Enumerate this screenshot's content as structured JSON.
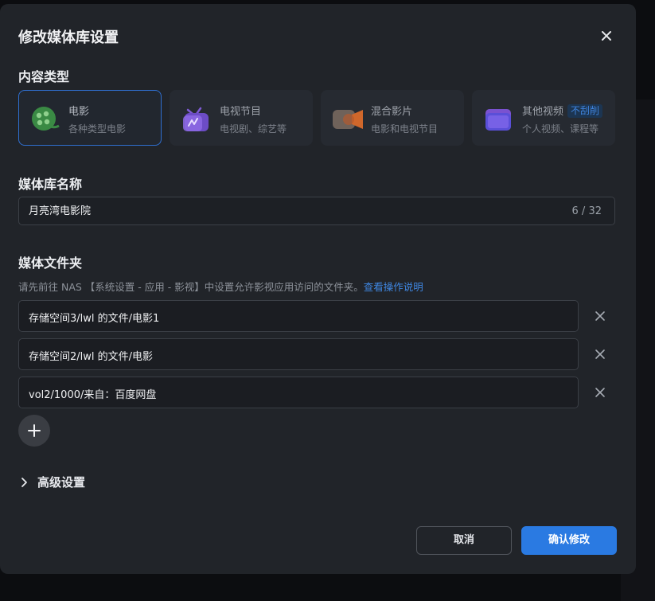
{
  "dialog": {
    "title": "修改媒体库设置"
  },
  "content_type": {
    "label": "内容类型",
    "options": [
      {
        "title": "电影",
        "subtitle": "各种类型电影",
        "icon": "film-reel-icon",
        "selected": true
      },
      {
        "title": "电视节目",
        "subtitle": "电视剧、综艺等",
        "icon": "tv-icon",
        "selected": false
      },
      {
        "title": "混合影片",
        "subtitle": "电影和电视节目",
        "icon": "video-camera-icon",
        "selected": false
      },
      {
        "title": "其他视频",
        "badge": "不刮削",
        "subtitle": "个人视频、课程等",
        "icon": "folder-icon",
        "selected": false
      }
    ]
  },
  "library_name": {
    "label": "媒体库名称",
    "value": "月亮湾电影院",
    "counter": "6 / 32"
  },
  "media_folders": {
    "label": "媒体文件夹",
    "hint": "请先前往 NAS 【系统设置 - 应用 - 影视】中设置允许影视应用访问的文件夹。",
    "hint_link": "查看操作说明",
    "folders": [
      "存储空间3/lwl 的文件/电影1",
      "存储空间2/lwl 的文件/电影",
      "vol2/1000/来自：百度网盘"
    ]
  },
  "advanced": {
    "label": "高级设置"
  },
  "actions": {
    "cancel": "取消",
    "confirm": "确认修改"
  },
  "colors": {
    "accent": "#2a7ae2",
    "dialog_bg": "#212429",
    "selected_border": "#2f6fd0"
  }
}
